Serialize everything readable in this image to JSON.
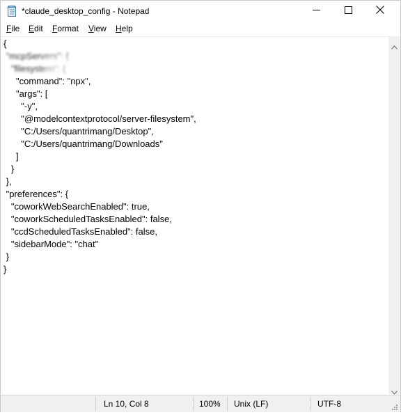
{
  "window": {
    "title": "*claude_desktop_config - Notepad"
  },
  "menu": {
    "file_u": "F",
    "file_rest": "ile",
    "edit_u": "E",
    "edit_rest": "dit",
    "format_u": "F",
    "format_pre": "",
    "format_rest": "ormat",
    "view_u": "V",
    "view_rest": "iew",
    "help_u": "H",
    "help_rest": "elp"
  },
  "editor": {
    "lines": [
      "{",
      " \"mcpServers\": {",
      "   \"filesystem\": {",
      "     \"command\": \"npx\",",
      "     \"args\": [",
      "       \"-y\",",
      "       \"@modelcontextprotocol/server-filesystem\",",
      "       \"C:/Users/quantrimang/Desktop\",",
      "       \"C:/Users/quantrimang/Downloads\"",
      "     ]",
      "   }",
      " },",
      " \"preferences\": {",
      "   \"coworkWebSearchEnabled\": true,",
      "   \"coworkScheduledTasksEnabled\": false,",
      "   \"ccdScheduledTasksEnabled\": false,",
      "   \"sidebarMode\": \"chat\"",
      " }",
      "}"
    ]
  },
  "status": {
    "position": "Ln 10, Col 8",
    "zoom": "100%",
    "line_ending": "Unix (LF)",
    "encoding": "UTF-8"
  },
  "icons": {
    "app": "notepad-icon",
    "minimize": "minimize-icon",
    "maximize": "maximize-icon",
    "close": "close-icon"
  },
  "colors": {
    "statusbar_bg": "#f0f0f0",
    "scrollbar_bg": "#f0f0f0",
    "text": "#000000"
  }
}
